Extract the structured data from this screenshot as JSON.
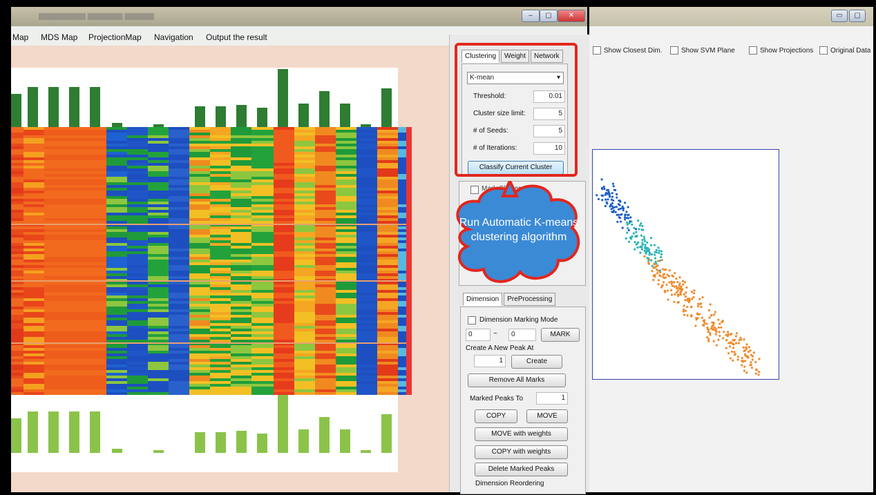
{
  "left_window": {
    "menu": [
      "Map",
      "MDS Map",
      "ProjectionMap",
      "Navigation",
      "Output the result"
    ]
  },
  "clustering_panel": {
    "tabs": [
      "Clustering",
      "Weight",
      "Network"
    ],
    "algorithm": "K-mean",
    "fields": [
      {
        "label": "Threshold:",
        "value": "0.01"
      },
      {
        "label": "Cluster size limit:",
        "value": "5"
      },
      {
        "label": "# of Seeds:",
        "value": "5"
      },
      {
        "label": "# of Iterations:",
        "value": "10"
      }
    ],
    "classify_button": "Classify Current Cluster",
    "hidden_checkbox_label": "Mark Clusters"
  },
  "callout": {
    "text": "Run Automatic K-means clustering algorithm"
  },
  "dimension_panel": {
    "tabs": [
      "Dimension",
      "PreProcessing"
    ],
    "marking_mode_label": "Dimension Marking Mode",
    "range_from": "0",
    "range_to": "0",
    "tilde": "~",
    "mark_button": "MARK",
    "new_peak_label": "Create A New Peak At",
    "new_peak_value": "1",
    "create_button": "Create",
    "remove_all_button": "Remove All Marks",
    "marked_peaks_label": "Marked Peaks To",
    "marked_peaks_value": "1",
    "copy_button": "COPY",
    "move_button": "MOVE",
    "move_weights_button": "MOVE with weights",
    "copy_weights_button": "COPY with weights",
    "delete_peaks_button": "Delete Marked Peaks",
    "reorder_label": "Dimension Reordering"
  },
  "right_window": {
    "options": [
      "Show Closest Dim.",
      "Show SVM Plane",
      "Show Projections",
      "Original Data"
    ]
  },
  "colors": {
    "highlight": "#e3261d",
    "callout_fill": "#3b8ad6",
    "bar_dark": "#2e7d32",
    "bar_light": "#8bc34a"
  }
}
